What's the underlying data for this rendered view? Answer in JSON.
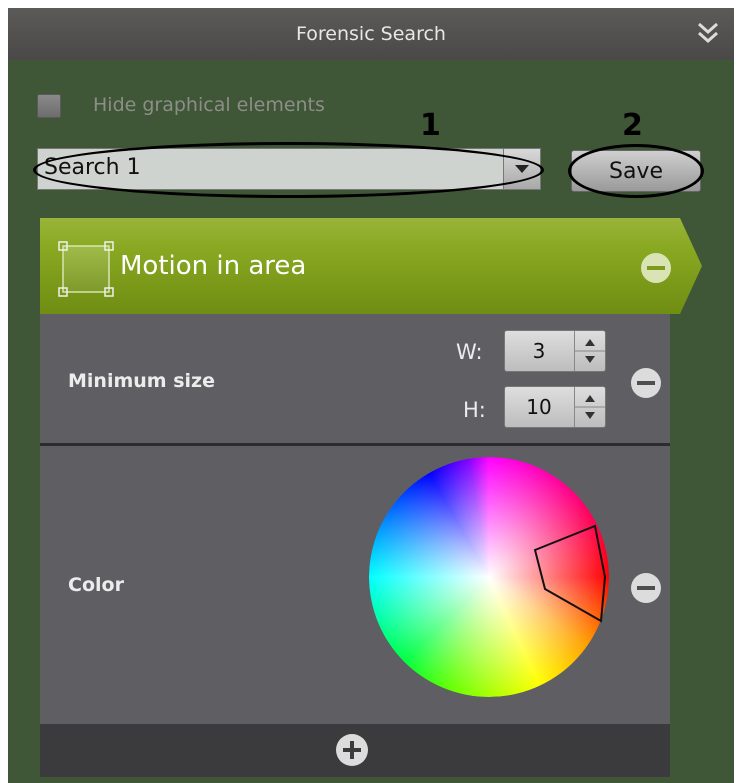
{
  "panel": {
    "title": "Forensic Search",
    "collapse_icon": "double-chevron-down-icon"
  },
  "options": {
    "hide_graphical_label": "Hide graphical elements",
    "hide_graphical_checked": false
  },
  "annotations": {
    "combo_marker": "1",
    "save_marker": "2"
  },
  "search": {
    "value": "Search 1",
    "dropdown_icon": "chevron-down-icon"
  },
  "toolbar": {
    "save_label": "Save"
  },
  "condition": {
    "title": "Motion in area",
    "header_color": "#8aa922",
    "icon": "area-selection-icon"
  },
  "min_size": {
    "label": "Minimum size",
    "w_label": "W:",
    "w_value": "3",
    "h_label": "H:",
    "h_value": "10"
  },
  "color": {
    "label": "Color",
    "selected_hue_range": "red"
  },
  "footer": {
    "add_icon": "plus-icon"
  }
}
